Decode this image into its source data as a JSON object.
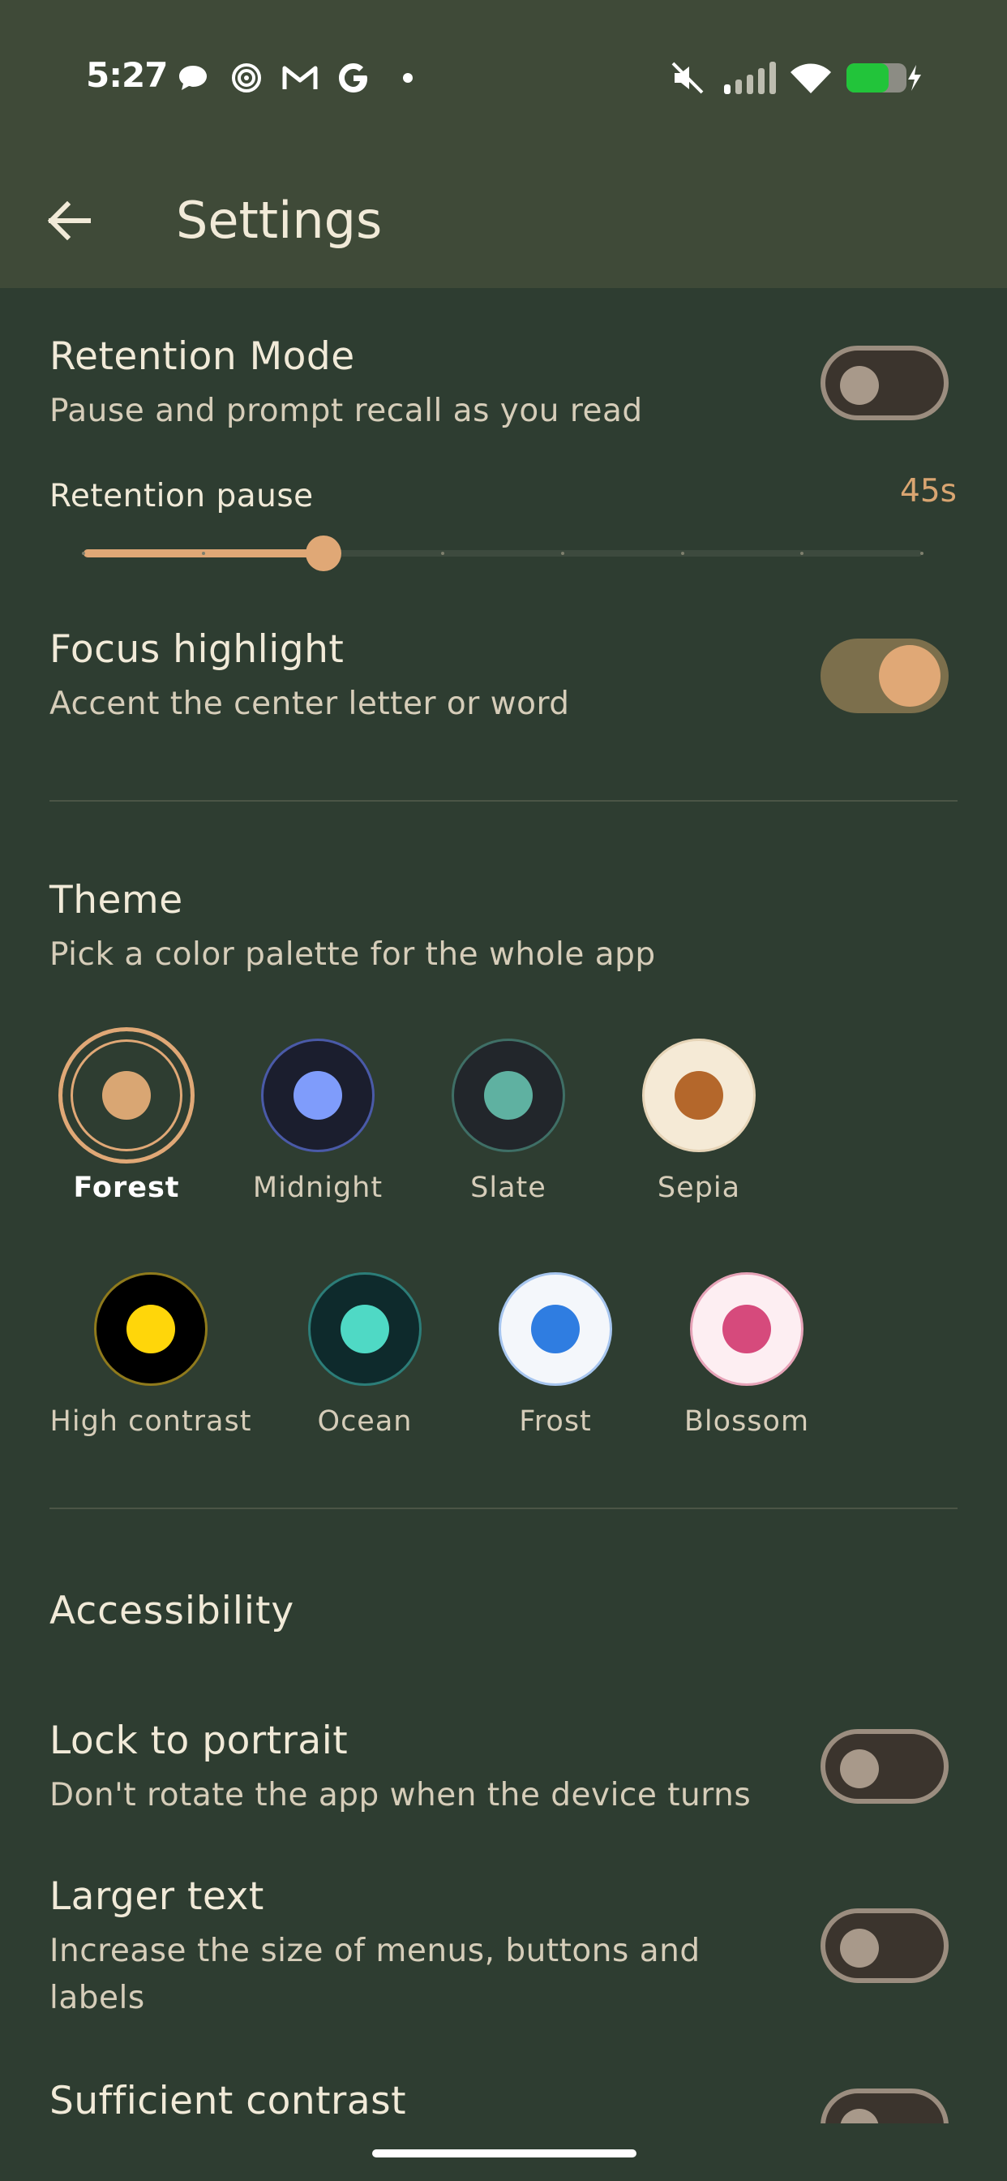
{
  "status_bar": {
    "time": "5:27",
    "left_icons": [
      "chat-bubble-icon",
      "spiral-icon",
      "gmail-icon",
      "google-icon",
      "dot-icon"
    ],
    "right_icons": [
      "muted-speaker-icon",
      "cell-signal-icon",
      "wifi-icon",
      "battery-charging-icon"
    ]
  },
  "app_bar": {
    "title": "Settings",
    "back_icon": "arrow-left-icon"
  },
  "retention_mode": {
    "title": "Retention Mode",
    "subtitle": "Pause and prompt recall as you read",
    "enabled": false
  },
  "retention_pause": {
    "label": "Retention pause",
    "value": "45s",
    "position_fraction": 0.286,
    "step_count": 7
  },
  "focus_highlight": {
    "title": "Focus highlight",
    "subtitle": "Accent the center letter or word",
    "enabled": true
  },
  "theme": {
    "title": "Theme",
    "subtitle": "Pick a color palette for the whole app",
    "selected": "Forest",
    "options": [
      {
        "name": "Forest",
        "ring": "#2e3d31",
        "border": "#e0a876",
        "dot": "#d9a673"
      },
      {
        "name": "Midnight",
        "ring": "#1b1e2e",
        "border": "#4a5aa8",
        "dot": "#7f9cfb"
      },
      {
        "name": "Slate",
        "ring": "#22262b",
        "border": "#3f6f66",
        "dot": "#5fb1a1"
      },
      {
        "name": "Sepia",
        "ring": "#f5ead6",
        "border": "#e6d4b7",
        "dot": "#b4672b"
      },
      {
        "name": "High contrast",
        "ring": "#000000",
        "border": "#8f7a1c",
        "dot": "#ffd60a"
      },
      {
        "name": "Ocean",
        "ring": "#0e2a2c",
        "border": "#2c7d78",
        "dot": "#4fd9c5"
      },
      {
        "name": "Frost",
        "ring": "#f4f7fb",
        "border": "#a7c6ef",
        "dot": "#2f7de1"
      },
      {
        "name": "Blossom",
        "ring": "#fdeef2",
        "border": "#e7a3b8",
        "dot": "#d64a7c"
      }
    ]
  },
  "accessibility": {
    "title": "Accessibility",
    "lock_portrait": {
      "title": "Lock to portrait",
      "subtitle": "Don't rotate the app when the device turns",
      "enabled": false
    },
    "larger_text": {
      "title": "Larger text",
      "subtitle_line1": "Increase the size of menus, buttons and",
      "subtitle_line2": "labels",
      "enabled": false
    },
    "sufficient_contrast": {
      "title": "Sufficient contrast",
      "enabled": false
    }
  }
}
